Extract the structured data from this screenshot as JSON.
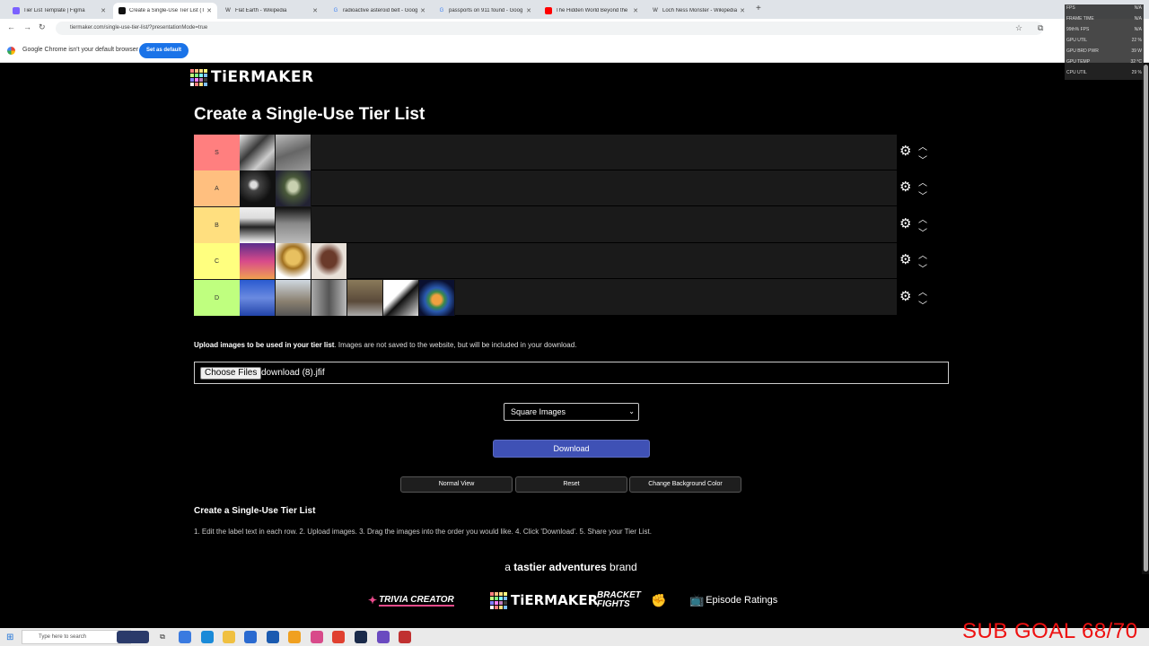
{
  "browser": {
    "tabs": [
      {
        "label": "Tier List Template | Figma",
        "icon": "figma-icon",
        "color": "#7b61ff"
      },
      {
        "label": "Create a Single-Use Tier List (Tr",
        "icon": "tiermaker-icon",
        "color": "#111111"
      },
      {
        "label": "Flat Earth - Wikipedia",
        "icon": "wikipedia-icon",
        "color": "#666666"
      },
      {
        "label": "radioactive asteroid belt - Goog",
        "icon": "google-icon",
        "color": "#4285f4"
      },
      {
        "label": "passports on 911 found - Goog",
        "icon": "google-icon",
        "color": "#4285f4"
      },
      {
        "label": "The Hidden World Beyond the",
        "icon": "youtube-icon",
        "color": "#ff0000"
      },
      {
        "label": "Loch Ness Monster - Wikipedia",
        "icon": "wikipedia-icon",
        "color": "#666666"
      }
    ],
    "new_tab": "+",
    "url": "tiermaker.com/single-use-tier-list/?presentationMode=true",
    "infobar": {
      "text": "Google Chrome isn't your default browser",
      "button": "Set as default"
    }
  },
  "site": {
    "logo_text": "TiERMAKER",
    "page_title": "Create a Single-Use Tier List"
  },
  "tiers": [
    {
      "label": "S",
      "color": "#ff7f7f",
      "item_count": 2
    },
    {
      "label": "A",
      "color": "#ffbf7f",
      "item_count": 2
    },
    {
      "label": "B",
      "color": "#ffdf7f",
      "item_count": 2
    },
    {
      "label": "C",
      "color": "#ffff7f",
      "item_count": 3
    },
    {
      "label": "D",
      "color": "#bfff7f",
      "item_count": 6
    }
  ],
  "upload": {
    "bold_text": "Upload images to be used in your tier list",
    "text": ". Images are not saved to the website, but will be included in your download.",
    "choose_button": "Choose Files",
    "file_name": "download (8).jfif"
  },
  "controls": {
    "image_shape": "Square Images",
    "download": "Download",
    "normal_view": "Normal View",
    "reset": "Reset",
    "change_bg": "Change Background Color"
  },
  "instructions": {
    "title": "Create a Single-Use Tier List",
    "text": "1. Edit the label text in each row. 2. Upload images. 3. Drag the images into the order you would like. 4. Click 'Download'. 5. Share your Tier List."
  },
  "brand_line": {
    "prefix": "a",
    "bold": "tastier adventures",
    "suffix": "brand"
  },
  "brands": [
    {
      "label": "TRIVIA CREATOR"
    },
    {
      "label": "TiERMAKER"
    },
    {
      "label": "BRACKET FIGHTS"
    },
    {
      "label": "Episode Ratings"
    }
  ],
  "perf_overlay": [
    {
      "label": "FPS",
      "value": "N/A"
    },
    {
      "label": "FRAME TIME",
      "value": "N/A"
    },
    {
      "label": "99th% FPS",
      "value": "N/A"
    },
    {
      "label": "GPU UTIL",
      "value": "22 %"
    },
    {
      "label": "GPU BRD PWR",
      "value": "39 W"
    },
    {
      "label": "GPU TEMP",
      "value": "32 °C"
    },
    {
      "label": "CPU UTIL",
      "value": "29 %"
    }
  ],
  "stream_overlay": "SUB GOAL 68/70",
  "taskbar": {
    "search_placeholder": "Type here to search"
  }
}
